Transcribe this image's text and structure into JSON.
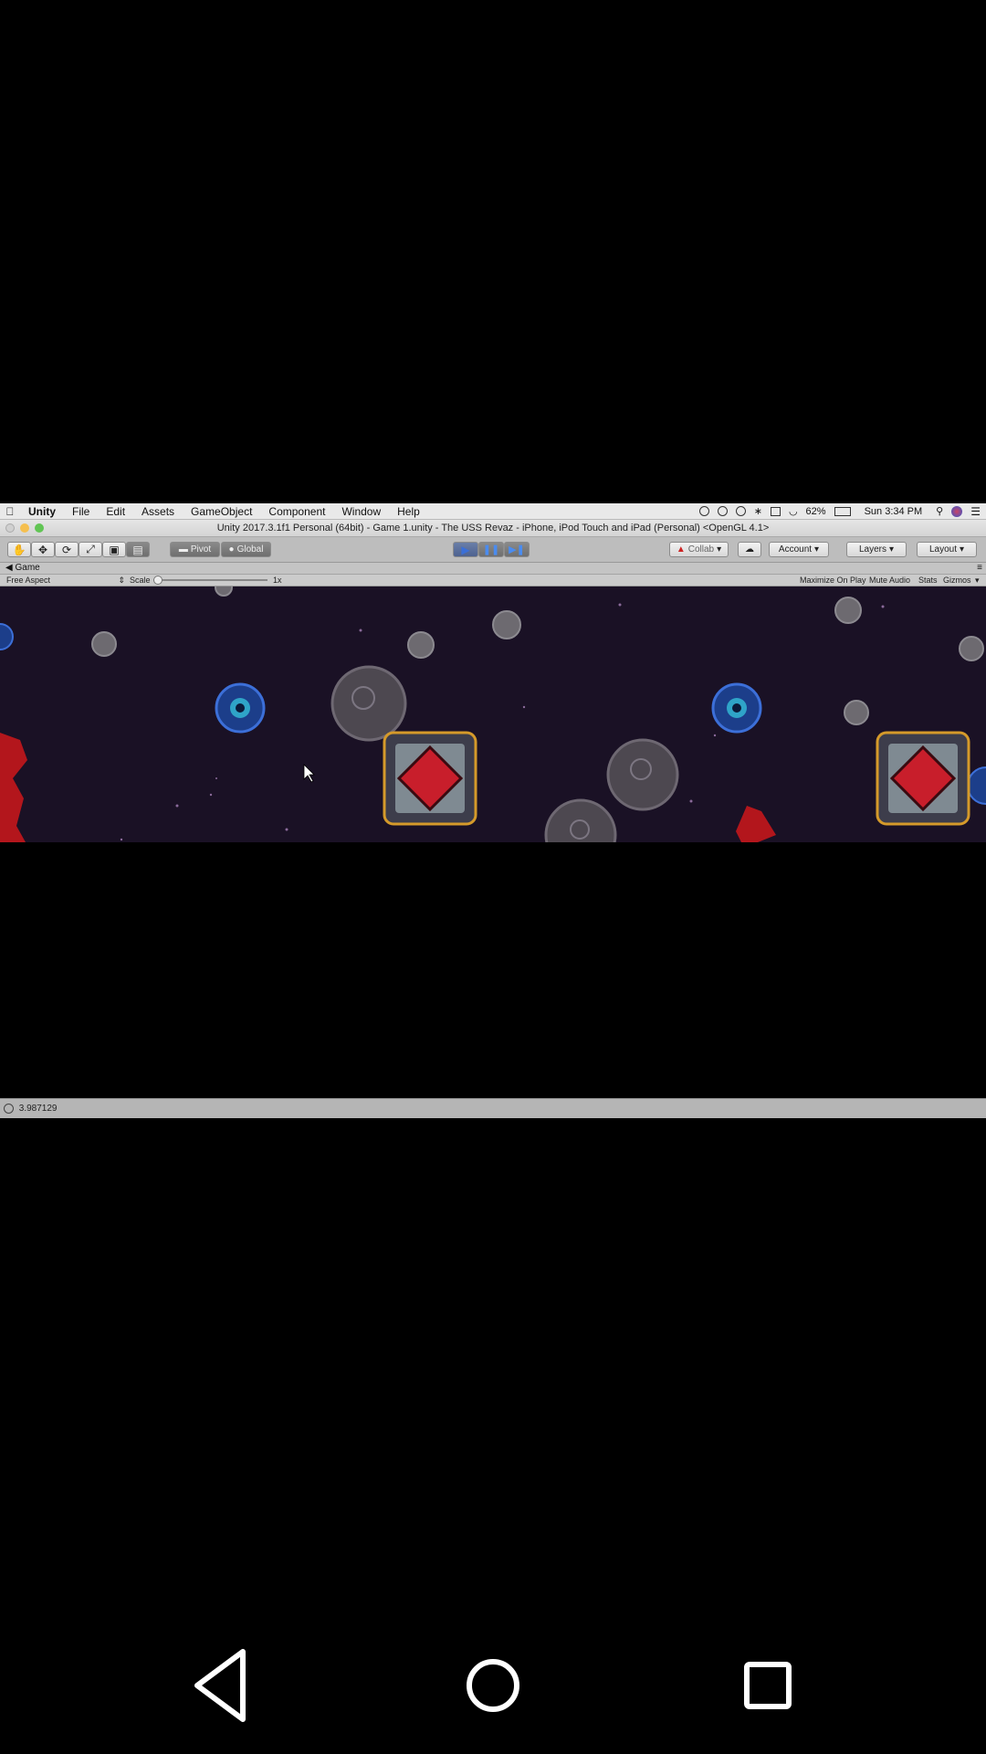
{
  "menubar": {
    "apple_icon": "apple-logo-icon",
    "items": [
      "Unity",
      "File",
      "Edit",
      "Assets",
      "GameObject",
      "Component",
      "Window",
      "Help"
    ],
    "battery": "62%",
    "clock": "Sun 3:34 PM"
  },
  "window": {
    "title": "Unity 2017.3.1f1 Personal (64bit) - Game 1.unity - The USS Revaz - iPhone, iPod Touch and iPad (Personal) <OpenGL 4.1>"
  },
  "toolbar": {
    "pivot_label": "Pivot",
    "global_label": "Global",
    "collab_label": "Collab",
    "account_label": "Account",
    "layers_label": "Layers",
    "layout_label": "Layout"
  },
  "game_tab": {
    "tab_label": "Game",
    "aspect_label": "Free Aspect",
    "scale_label": "Scale",
    "scale_value": "1x",
    "maximize_label": "Maximize On Play",
    "mute_label": "Mute Audio",
    "stats_label": "Stats",
    "gizmos_label": "Gizmos"
  },
  "console": {
    "last_message": "3.987129"
  },
  "colors": {
    "space_bg": "#1a1125",
    "play_active": "#3a6fd8"
  }
}
